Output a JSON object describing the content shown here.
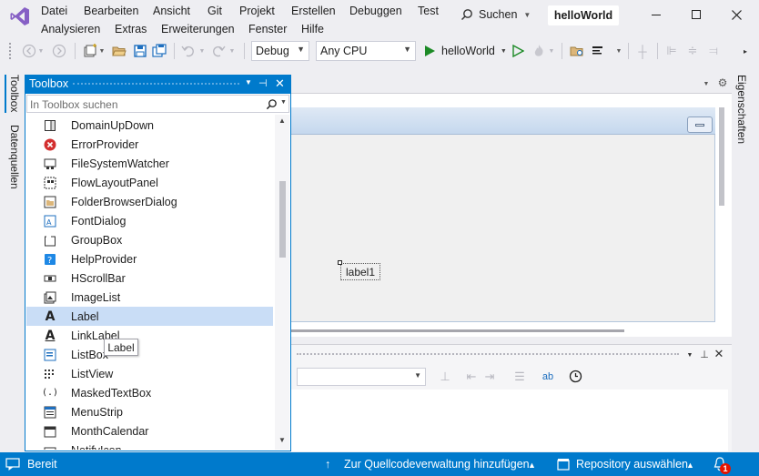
{
  "menu": {
    "row1": [
      "Datei",
      "Bearbeiten",
      "Ansicht",
      "Git",
      "Projekt",
      "Erstellen",
      "Debuggen",
      "Test"
    ],
    "row2": [
      "Analysieren",
      "Extras",
      "Erweiterungen",
      "Fenster",
      "Hilfe"
    ],
    "search_label": "Suchen",
    "solution_name": "helloWorld"
  },
  "toolbar": {
    "config": "Debug",
    "platform": "Any CPU",
    "run_target": "helloWorld"
  },
  "side_tabs": {
    "left": [
      "Toolbox",
      "Datenquellen"
    ],
    "right": "Eigenschaften"
  },
  "toolbox": {
    "title": "Toolbox",
    "search_placeholder": "In Toolbox suchen",
    "items": [
      {
        "label": "DomainUpDown",
        "icon": "domainupdown-icon"
      },
      {
        "label": "ErrorProvider",
        "icon": "error-provider-icon"
      },
      {
        "label": "FileSystemWatcher",
        "icon": "filesystemwatcher-icon"
      },
      {
        "label": "FlowLayoutPanel",
        "icon": "flowlayoutpanel-icon"
      },
      {
        "label": "FolderBrowserDialog",
        "icon": "folder-browser-icon"
      },
      {
        "label": "FontDialog",
        "icon": "font-dialog-icon"
      },
      {
        "label": "GroupBox",
        "icon": "groupbox-icon"
      },
      {
        "label": "HelpProvider",
        "icon": "help-provider-icon"
      },
      {
        "label": "HScrollBar",
        "icon": "hscrollbar-icon"
      },
      {
        "label": "ImageList",
        "icon": "imagelist-icon"
      },
      {
        "label": "Label",
        "icon": "label-icon"
      },
      {
        "label": "LinkLabel",
        "icon": "linklabel-icon"
      },
      {
        "label": "ListBox",
        "icon": "listbox-icon"
      },
      {
        "label": "ListView",
        "icon": "listview-icon"
      },
      {
        "label": "MaskedTextBox",
        "icon": "maskedtextbox-icon"
      },
      {
        "label": "MenuStrip",
        "icon": "menustrip-icon"
      },
      {
        "label": "MonthCalendar",
        "icon": "monthcalendar-icon"
      },
      {
        "label": "NotifyIcon",
        "icon": "notifyicon-icon"
      }
    ],
    "tooltip": "Label"
  },
  "designer": {
    "label_control": "label1"
  },
  "statusbar": {
    "ready": "Bereit",
    "source_control": "Zur Quellcodeverwaltung hinzufügen",
    "repository": "Repository auswählen",
    "notification_count": "1",
    "accent": "#007acc"
  }
}
